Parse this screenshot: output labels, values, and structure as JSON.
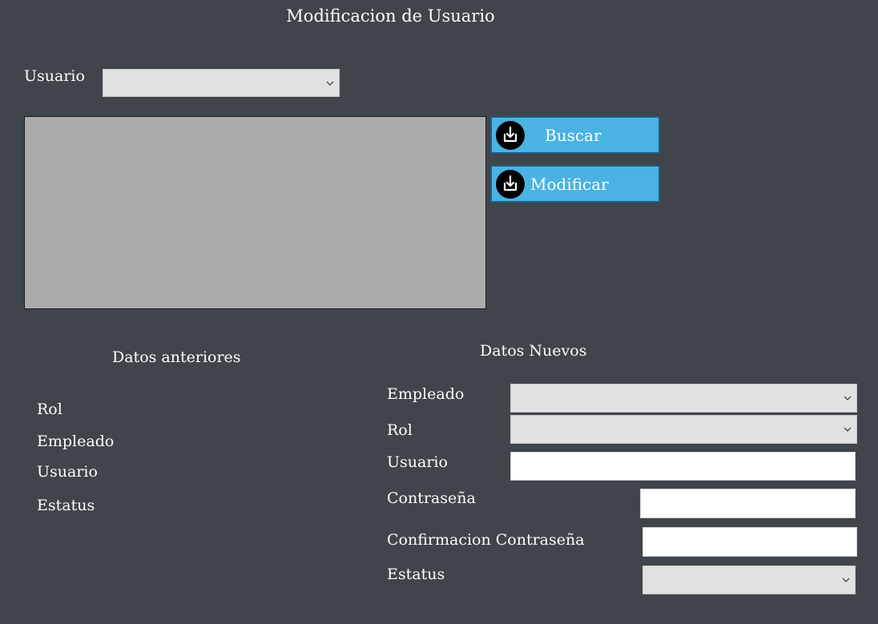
{
  "window": {
    "title": "Modificacion de Usuario"
  },
  "search": {
    "usuario_label": "Usuario",
    "usuario_selected": ""
  },
  "buttons": {
    "buscar_label": "Buscar",
    "modificar_label": "Modificar",
    "icon": "download-icon"
  },
  "previous": {
    "heading": "Datos anteriores",
    "rol_label": "Rol",
    "empleado_label": "Empleado",
    "usuario_label": "Usuario",
    "estatus_label": "Estatus"
  },
  "new": {
    "heading": "Datos Nuevos",
    "empleado_label": "Empleado",
    "rol_label": "Rol",
    "usuario_label": "Usuario",
    "contrasena_label": "Contraseña",
    "confirmacion_label": "Confirmacion Contraseña",
    "estatus_label": "Estatus",
    "empleado_value": "",
    "rol_value": "",
    "usuario_value": "",
    "contrasena_value": "",
    "confirmacion_value": "",
    "estatus_value": ""
  },
  "colors": {
    "background": "#40444b",
    "button": "#4ab3e3",
    "grid": "#ababab"
  }
}
